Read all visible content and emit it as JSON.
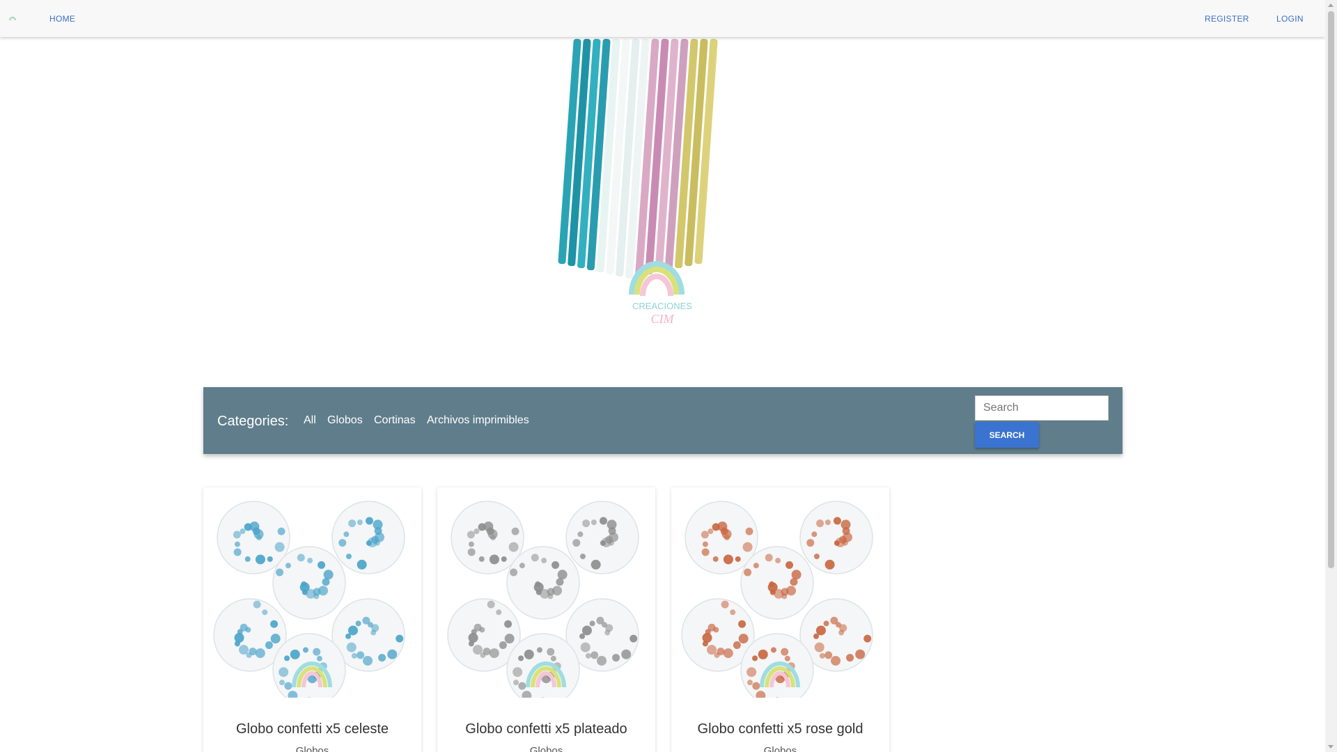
{
  "nav": {
    "home_label": "HOME",
    "register_label": "REGISTER",
    "login_label": "LOGIN"
  },
  "hero": {
    "image_icon": "candles-banner-image",
    "logo_text_line1": "CREACIONES",
    "logo_text_line2": "CIM"
  },
  "categories": {
    "title": "Categories:",
    "items": [
      {
        "label": "All"
      },
      {
        "label": "Globos"
      },
      {
        "label": "Cortinas"
      },
      {
        "label": "Archivos imprimibles"
      }
    ]
  },
  "search": {
    "placeholder": "Search",
    "button_label": "SEARCH",
    "button_color": "#3b73d1"
  },
  "colors": {
    "nav_link": "#3a6fc4",
    "category_bar": "#607d8b"
  },
  "products": [
    {
      "title": "Globo confetti x5 celeste",
      "category": "Globos",
      "confetti_color": "#4aa3c9",
      "image_icon": "balloons-celeste-image"
    },
    {
      "title": "Globo confetti x5 plateado",
      "category": "Globos",
      "confetti_color": "#8c8c8c",
      "image_icon": "balloons-silver-image"
    },
    {
      "title": "Globo confetti x5 rose gold",
      "category": "Globos",
      "confetti_color": "#c8653f",
      "image_icon": "balloons-rosegold-image"
    }
  ]
}
